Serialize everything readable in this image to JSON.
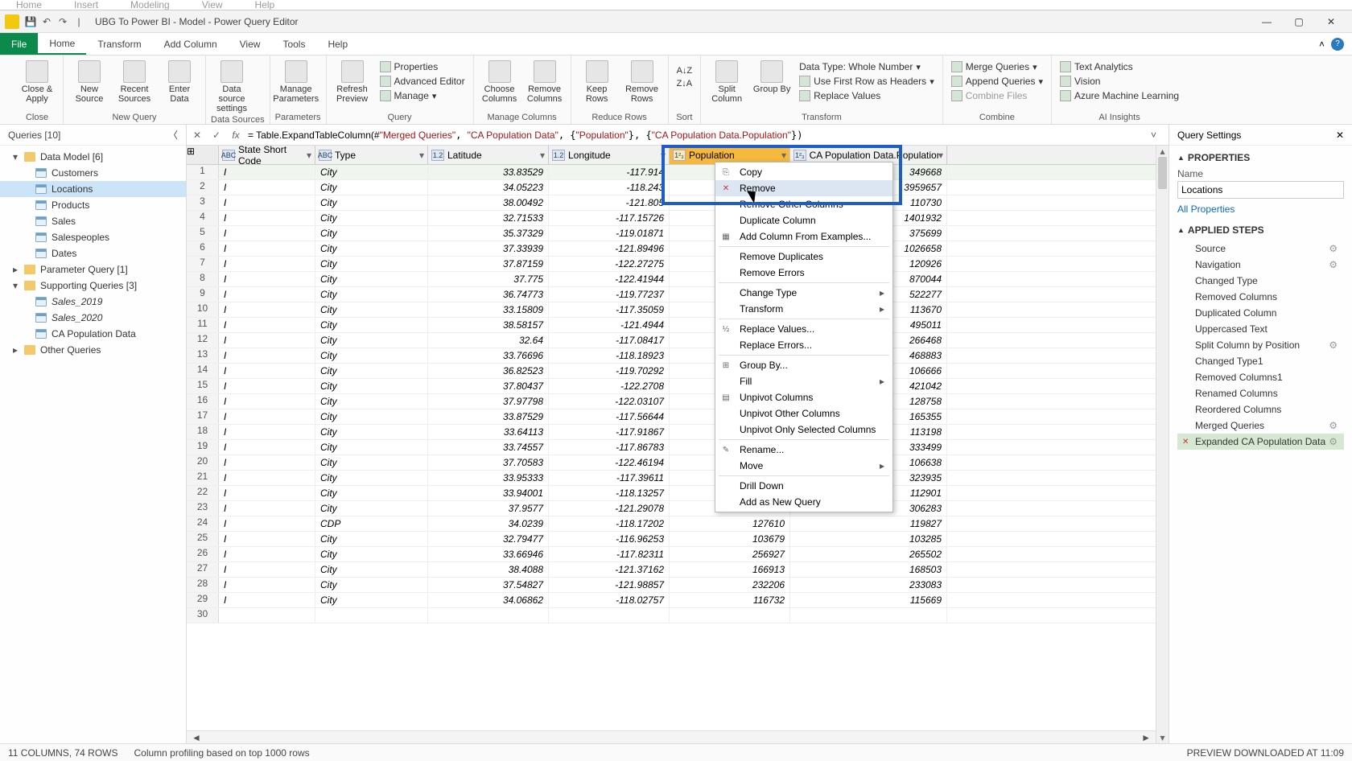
{
  "outer_menu": [
    "Home",
    "Insert",
    "Modeling",
    "View",
    "Help"
  ],
  "titlebar": {
    "title": "UBG To Power BI - Model - Power Query Editor"
  },
  "ribbon_tabs": {
    "file": "File",
    "tabs": [
      "Home",
      "Transform",
      "Add Column",
      "View",
      "Tools",
      "Help"
    ],
    "active": "Home"
  },
  "ribbon": {
    "close": {
      "close_apply": "Close &\nApply",
      "group": "Close"
    },
    "newquery": {
      "new_source": "New\nSource",
      "recent": "Recent\nSources",
      "enter": "Enter\nData",
      "group": "New Query"
    },
    "datasources": {
      "settings": "Data source\nsettings",
      "group": "Data Sources"
    },
    "parameters": {
      "manage": "Manage\nParameters",
      "group": "Parameters"
    },
    "query": {
      "refresh": "Refresh\nPreview",
      "properties": "Properties",
      "advanced": "Advanced Editor",
      "managebtn": "Manage",
      "group": "Query"
    },
    "manage_cols": {
      "choose": "Choose\nColumns",
      "remove": "Remove\nColumns",
      "group": "Manage Columns"
    },
    "reduce_rows": {
      "keep": "Keep\nRows",
      "remove": "Remove\nRows",
      "group": "Reduce Rows"
    },
    "sort": {
      "group": "Sort"
    },
    "transform": {
      "split": "Split\nColumn",
      "groupby": "Group\nBy",
      "datatype": "Data Type: Whole Number",
      "firstrow": "Use First Row as Headers",
      "replace": "Replace Values",
      "group": "Transform"
    },
    "combine": {
      "merge": "Merge Queries",
      "append": "Append Queries",
      "files": "Combine Files",
      "group": "Combine"
    },
    "ai": {
      "text": "Text Analytics",
      "vision": "Vision",
      "aml": "Azure Machine Learning",
      "group": "AI Insights"
    }
  },
  "queries": {
    "header": "Queries [10]",
    "groups": [
      {
        "name": "Data Model [6]",
        "items": [
          {
            "name": "Customers"
          },
          {
            "name": "Locations",
            "selected": true
          },
          {
            "name": "Products"
          },
          {
            "name": "Sales"
          },
          {
            "name": "Salespeoples"
          },
          {
            "name": "Dates"
          }
        ]
      },
      {
        "name": "Parameter Query [1]",
        "items": []
      },
      {
        "name": "Supporting Queries [3]",
        "items": [
          {
            "name": "Sales_2019",
            "italic": true
          },
          {
            "name": "Sales_2020",
            "italic": true
          },
          {
            "name": "CA Population Data"
          }
        ]
      },
      {
        "name": "Other Queries",
        "items": []
      }
    ]
  },
  "formula": {
    "prefix": "= Table.ExpandTableColumn(#",
    "s1": "\"Merged Queries\"",
    "s2": "\"CA Population Data\"",
    "s3": "\"Population\"",
    "s4": "\"CA Population Data.Population\""
  },
  "columns": [
    {
      "type": "ABC",
      "label": "State Short Code",
      "cls": "col-ssc"
    },
    {
      "type": "ABC",
      "label": "Type",
      "cls": "col-type"
    },
    {
      "type": "1.2",
      "label": "Latitude",
      "cls": "col-lat",
      "right": true
    },
    {
      "type": "1.2",
      "label": "Longitude",
      "cls": "col-lon",
      "right": true
    },
    {
      "type": "1²₃",
      "label": "Population",
      "cls": "col-pop",
      "right": true,
      "selected": true
    },
    {
      "type": "1²₃",
      "label": "CA Population Data.Population",
      "cls": "col-capop",
      "right": true
    }
  ],
  "rows": [
    {
      "n": 1,
      "ssc": "I",
      "type": "City",
      "lat": "33.83529",
      "lon": "-117.914",
      "pop": "",
      "capop": "349668",
      "sel": true
    },
    {
      "n": 2,
      "ssc": "I",
      "type": "City",
      "lat": "34.05223",
      "lon": "-118.243",
      "pop": "",
      "capop": "3959657"
    },
    {
      "n": 3,
      "ssc": "I",
      "type": "City",
      "lat": "38.00492",
      "lon": "-121.805",
      "pop": "",
      "capop": "110730"
    },
    {
      "n": 4,
      "ssc": "I",
      "type": "City",
      "lat": "32.71533",
      "lon": "-117.15726",
      "pop": "",
      "capop": "1401932"
    },
    {
      "n": 5,
      "ssc": "I",
      "type": "City",
      "lat": "35.37329",
      "lon": "-119.01871",
      "pop": "",
      "capop": "375699"
    },
    {
      "n": 6,
      "ssc": "I",
      "type": "City",
      "lat": "37.33939",
      "lon": "-121.89496",
      "pop": "",
      "capop": "1026658"
    },
    {
      "n": 7,
      "ssc": "I",
      "type": "City",
      "lat": "37.87159",
      "lon": "-122.27275",
      "pop": "",
      "capop": "120926"
    },
    {
      "n": 8,
      "ssc": "I",
      "type": "City",
      "lat": "37.775",
      "lon": "-122.41944",
      "pop": "",
      "capop": "870044"
    },
    {
      "n": 9,
      "ssc": "I",
      "type": "City",
      "lat": "36.74773",
      "lon": "-119.77237",
      "pop": "",
      "capop": "522277"
    },
    {
      "n": 10,
      "ssc": "I",
      "type": "City",
      "lat": "33.15809",
      "lon": "-117.35059",
      "pop": "",
      "capop": "113670"
    },
    {
      "n": 11,
      "ssc": "I",
      "type": "City",
      "lat": "38.58157",
      "lon": "-121.4944",
      "pop": "",
      "capop": "495011"
    },
    {
      "n": 12,
      "ssc": "I",
      "type": "City",
      "lat": "32.64",
      "lon": "-117.08417",
      "pop": "",
      "capop": "266468"
    },
    {
      "n": 13,
      "ssc": "I",
      "type": "City",
      "lat": "33.76696",
      "lon": "-118.18923",
      "pop": "",
      "capop": "468883"
    },
    {
      "n": 14,
      "ssc": "I",
      "type": "City",
      "lat": "36.82523",
      "lon": "-119.70292",
      "pop": "",
      "capop": "106666"
    },
    {
      "n": 15,
      "ssc": "I",
      "type": "City",
      "lat": "37.80437",
      "lon": "-122.2708",
      "pop": "",
      "capop": "421042"
    },
    {
      "n": 16,
      "ssc": "I",
      "type": "City",
      "lat": "37.97798",
      "lon": "-122.03107",
      "pop": "",
      "capop": "128758"
    },
    {
      "n": 17,
      "ssc": "I",
      "type": "City",
      "lat": "33.87529",
      "lon": "-117.56644",
      "pop": "",
      "capop": "165355"
    },
    {
      "n": 18,
      "ssc": "I",
      "type": "City",
      "lat": "33.64113",
      "lon": "-117.91867",
      "pop": "",
      "capop": "113198"
    },
    {
      "n": 19,
      "ssc": "I",
      "type": "City",
      "lat": "33.74557",
      "lon": "-117.86783",
      "pop": "",
      "capop": "333499"
    },
    {
      "n": 20,
      "ssc": "I",
      "type": "City",
      "lat": "37.70583",
      "lon": "-122.46194",
      "pop": "",
      "capop": "106638"
    },
    {
      "n": 21,
      "ssc": "I",
      "type": "City",
      "lat": "33.95333",
      "lon": "-117.39611",
      "pop": "",
      "capop": "323935"
    },
    {
      "n": 22,
      "ssc": "I",
      "type": "City",
      "lat": "33.94001",
      "lon": "-118.13257",
      "pop": "",
      "capop": "112901"
    },
    {
      "n": 23,
      "ssc": "I",
      "type": "City",
      "lat": "37.9577",
      "lon": "-121.29078",
      "pop": "",
      "capop": "306283"
    },
    {
      "n": 24,
      "ssc": "I",
      "type": "CDP",
      "lat": "34.0239",
      "lon": "-118.17202",
      "pop": "127610",
      "capop": "119827"
    },
    {
      "n": 25,
      "ssc": "I",
      "type": "City",
      "lat": "32.79477",
      "lon": "-116.96253",
      "pop": "103679",
      "capop": "103285"
    },
    {
      "n": 26,
      "ssc": "I",
      "type": "City",
      "lat": "33.66946",
      "lon": "-117.82311",
      "pop": "256927",
      "capop": "265502"
    },
    {
      "n": 27,
      "ssc": "I",
      "type": "City",
      "lat": "38.4088",
      "lon": "-121.37162",
      "pop": "166913",
      "capop": "168503"
    },
    {
      "n": 28,
      "ssc": "I",
      "type": "City",
      "lat": "37.54827",
      "lon": "-121.98857",
      "pop": "232206",
      "capop": "233083"
    },
    {
      "n": 29,
      "ssc": "I",
      "type": "City",
      "lat": "34.06862",
      "lon": "-118.02757",
      "pop": "116732",
      "capop": "115669"
    },
    {
      "n": 30,
      "ssc": "",
      "type": "",
      "lat": "",
      "lon": "",
      "pop": "",
      "capop": ""
    }
  ],
  "context_menu": [
    {
      "label": "Copy",
      "icon": "⎘"
    },
    {
      "label": "Remove",
      "icon": "✕",
      "iconcolor": "#c33",
      "hover": true
    },
    {
      "label": "Remove Other Columns"
    },
    {
      "label": "Duplicate Column"
    },
    {
      "label": "Add Column From Examples...",
      "icon": "▦"
    },
    {
      "sep": true
    },
    {
      "label": "Remove Duplicates"
    },
    {
      "label": "Remove Errors"
    },
    {
      "sep": true
    },
    {
      "label": "Change Type",
      "sub": true
    },
    {
      "label": "Transform",
      "sub": true
    },
    {
      "sep": true
    },
    {
      "label": "Replace Values...",
      "icon": "½"
    },
    {
      "label": "Replace Errors..."
    },
    {
      "sep": true
    },
    {
      "label": "Group By...",
      "icon": "⊞"
    },
    {
      "label": "Fill",
      "sub": true
    },
    {
      "label": "Unpivot Columns",
      "icon": "▤"
    },
    {
      "label": "Unpivot Other Columns"
    },
    {
      "label": "Unpivot Only Selected Columns"
    },
    {
      "sep": true
    },
    {
      "label": "Rename...",
      "icon": "✎"
    },
    {
      "label": "Move",
      "sub": true
    },
    {
      "sep": true
    },
    {
      "label": "Drill Down"
    },
    {
      "label": "Add as New Query"
    }
  ],
  "settings": {
    "header": "Query Settings",
    "properties": "PROPERTIES",
    "name_label": "Name",
    "name_value": "Locations",
    "all_props": "All Properties",
    "applied_steps": "APPLIED STEPS",
    "steps": [
      {
        "name": "Source",
        "gear": true
      },
      {
        "name": "Navigation",
        "gear": true
      },
      {
        "name": "Changed Type"
      },
      {
        "name": "Removed Columns"
      },
      {
        "name": "Duplicated Column"
      },
      {
        "name": "Uppercased Text"
      },
      {
        "name": "Split Column by Position",
        "gear": true
      },
      {
        "name": "Changed Type1"
      },
      {
        "name": "Removed Columns1"
      },
      {
        "name": "Renamed Columns"
      },
      {
        "name": "Reordered Columns"
      },
      {
        "name": "Merged Queries",
        "gear": true
      },
      {
        "name": "Expanded CA Population Data",
        "selected": true,
        "gear": true
      }
    ]
  },
  "status": {
    "left1": "11 COLUMNS, 74 ROWS",
    "left2": "Column profiling based on top 1000 rows",
    "right": "PREVIEW DOWNLOADED AT 11:09"
  }
}
